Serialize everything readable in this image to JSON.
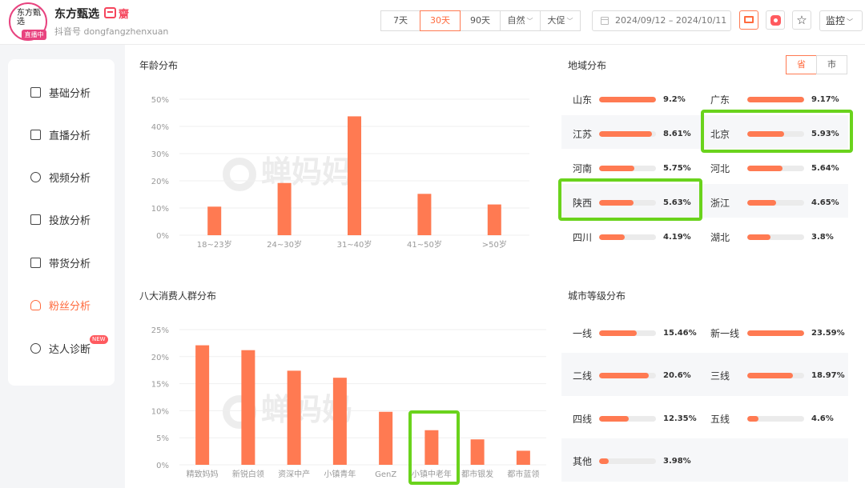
{
  "header": {
    "avatar_text": "东方甄选",
    "live_badge": "直播中",
    "account_name": "东方甄选",
    "account_id": "抖音号 dongfangzhenxuan",
    "live_icon_text": "直播",
    "ranges": [
      {
        "label": "7天",
        "active": false
      },
      {
        "label": "30天",
        "active": true
      },
      {
        "label": "90天",
        "active": false
      },
      {
        "label": "自然",
        "active": false
      },
      {
        "label": "大促",
        "active": false
      }
    ],
    "date_range": "2024/09/12  –  2024/10/11",
    "monitor_label": "监控",
    "icons": [
      "screen-icon",
      "app-icon",
      "star-icon",
      "calendar-icon"
    ]
  },
  "sidebar": {
    "items": [
      {
        "label": "基础分析",
        "icon": "chart-icon",
        "active": false
      },
      {
        "label": "直播分析",
        "icon": "live-icon",
        "active": false
      },
      {
        "label": "视频分析",
        "icon": "play-icon",
        "active": false
      },
      {
        "label": "投放分析",
        "icon": "box-icon",
        "active": false
      },
      {
        "label": "带货分析",
        "icon": "bag-icon",
        "active": false
      },
      {
        "label": "粉丝分析",
        "icon": "fans-icon",
        "active": true
      },
      {
        "label": "达人诊断",
        "icon": "diagnose-icon",
        "active": false,
        "badge": "NEW"
      }
    ]
  },
  "age": {
    "title": "年龄分布",
    "watermark": "蝉妈妈",
    "chart_data": {
      "type": "bar",
      "categories": [
        "18~23岁",
        "24~30岁",
        "31~40岁",
        "41~50岁",
        ">50岁"
      ],
      "values": [
        10.5,
        19.2,
        43.7,
        15.2,
        11.3
      ],
      "ylim": [
        0,
        50
      ],
      "yticks": [
        "0%",
        "10%",
        "20%",
        "30%",
        "40%",
        "50%"
      ],
      "grid": true,
      "color": "#ff7a52"
    }
  },
  "consumer": {
    "title": "八大消费人群分布",
    "watermark": "蝉妈妈",
    "chart_data": {
      "type": "bar",
      "categories": [
        "精致妈妈",
        "新锐白领",
        "资深中产",
        "小镇青年",
        "GenZ",
        "小镇中老年",
        "都市银发",
        "都市蓝领"
      ],
      "values": [
        22.1,
        21.2,
        17.4,
        16.1,
        9.8,
        6.4,
        4.7,
        2.6
      ],
      "ylim": [
        0,
        25
      ],
      "yticks": [
        "0%",
        "5%",
        "10%",
        "15%",
        "20%",
        "25%"
      ],
      "grid": true,
      "color": "#ff7a52"
    }
  },
  "region": {
    "title": "地域分布",
    "toggle": [
      {
        "label": "省",
        "active": true
      },
      {
        "label": "市",
        "active": false
      }
    ],
    "rows": [
      [
        {
          "label": "山东",
          "pct": "9.2%",
          "value": 9.2
        },
        {
          "label": "广东",
          "pct": "9.17%",
          "value": 9.17
        }
      ],
      [
        {
          "label": "江苏",
          "pct": "8.61%",
          "value": 8.61
        },
        {
          "label": "北京",
          "pct": "5.93%",
          "value": 5.93
        }
      ],
      [
        {
          "label": "河南",
          "pct": "5.75%",
          "value": 5.75
        },
        {
          "label": "河北",
          "pct": "5.64%",
          "value": 5.64
        }
      ],
      [
        {
          "label": "陕西",
          "pct": "5.63%",
          "value": 5.63
        },
        {
          "label": "浙江",
          "pct": "4.65%",
          "value": 4.65
        }
      ],
      [
        {
          "label": "四川",
          "pct": "4.19%",
          "value": 4.19
        },
        {
          "label": "湖北",
          "pct": "3.8%",
          "value": 3.8
        }
      ]
    ]
  },
  "city_tier": {
    "title": "城市等级分布",
    "rows": [
      [
        {
          "label": "一线",
          "pct": "15.46%",
          "value": 15.46
        },
        {
          "label": "新一线",
          "pct": "23.59%",
          "value": 23.59
        }
      ],
      [
        {
          "label": "二线",
          "pct": "20.6%",
          "value": 20.6
        },
        {
          "label": "三线",
          "pct": "18.97%",
          "value": 18.97
        }
      ],
      [
        {
          "label": "四线",
          "pct": "12.35%",
          "value": 12.35
        },
        {
          "label": "五线",
          "pct": "4.6%",
          "value": 4.6
        }
      ],
      [
        {
          "label": "其他",
          "pct": "3.98%",
          "value": 3.98
        }
      ]
    ]
  },
  "colors": {
    "accent": "#ff6a3d",
    "bar": "#ff7a52",
    "highlight": "#6ad31c",
    "live": "#e8437f"
  }
}
